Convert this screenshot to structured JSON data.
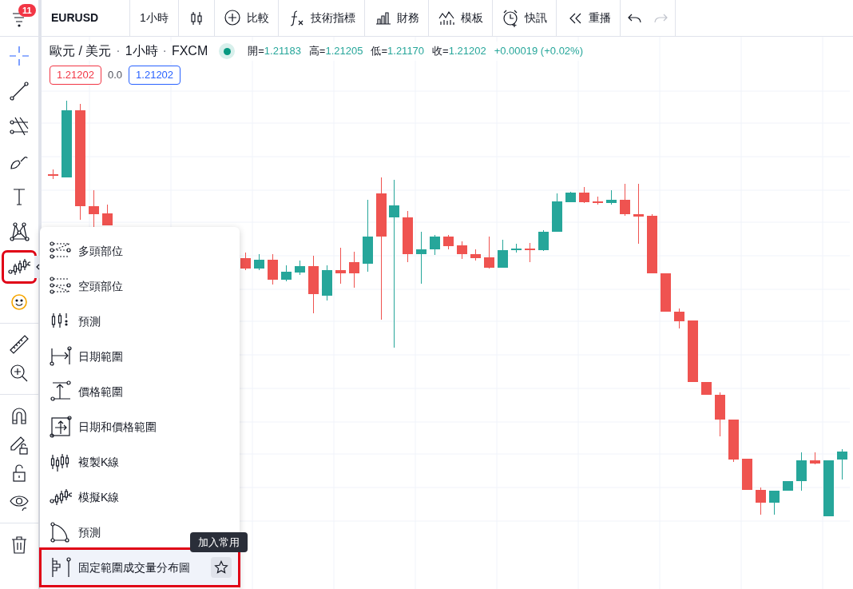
{
  "top_toolbar": {
    "menu_badge": "11",
    "symbol": "EURUSD",
    "interval": "1小時",
    "items": [
      {
        "kind": "compare",
        "label": "比較"
      },
      {
        "kind": "indicators",
        "label": "技術指標"
      },
      {
        "kind": "financials",
        "label": "財務"
      },
      {
        "kind": "templates",
        "label": "模板"
      },
      {
        "kind": "alert",
        "label": "快訊"
      },
      {
        "kind": "replay",
        "label": "重播"
      }
    ],
    "undo": {
      "disabled": false
    },
    "redo": {
      "disabled": true
    }
  },
  "legend": {
    "title": "歐元 / 美元",
    "interval": "1小時",
    "source": "FXCM",
    "separators": [
      "·",
      "·"
    ],
    "values": [
      {
        "label": "開=",
        "value": "1.21183"
      },
      {
        "label": "高=",
        "value": "1.21205"
      },
      {
        "label": "低=",
        "value": "1.21170"
      },
      {
        "label": "收=",
        "value": "1.21202"
      }
    ],
    "change": "+0.00019 (+0.02%)",
    "sell": "1.21202",
    "spread": "0.0",
    "buy": "1.21202"
  },
  "left_toolbar": [
    {
      "kind": "crosshair",
      "selected": true
    },
    {
      "kind": "trend-line",
      "selected": false
    },
    {
      "kind": "fib",
      "selected": false
    },
    {
      "kind": "brush",
      "selected": false
    },
    {
      "kind": "text",
      "selected": false
    },
    {
      "kind": "pattern",
      "selected": false
    },
    {
      "kind": "prediction",
      "selected": true
    },
    {
      "kind": "emoji",
      "selected": false
    },
    {
      "kind": "divider"
    },
    {
      "kind": "ruler",
      "selected": false
    },
    {
      "kind": "zoom",
      "selected": false
    },
    {
      "kind": "divider"
    },
    {
      "kind": "magnet",
      "selected": false
    },
    {
      "kind": "lock-drawing",
      "selected": false
    },
    {
      "kind": "lock",
      "selected": false
    },
    {
      "kind": "eye",
      "selected": false
    },
    {
      "kind": "divider"
    },
    {
      "kind": "trash",
      "selected": false
    }
  ],
  "tool_menu": {
    "items": [
      {
        "kind": "long",
        "label": "多頭部位",
        "hovered": false
      },
      {
        "kind": "short",
        "label": "空頭部位",
        "hovered": false
      },
      {
        "kind": "forecast",
        "label": "預測",
        "hovered": false
      },
      {
        "kind": "date-range",
        "label": "日期範圍",
        "hovered": false
      },
      {
        "kind": "price-range",
        "label": "價格範圍",
        "hovered": false
      },
      {
        "kind": "date-price-range",
        "label": "日期和價格範圍",
        "hovered": false
      },
      {
        "kind": "bars-pattern",
        "label": "複製K線",
        "hovered": false
      },
      {
        "kind": "ghost-feed",
        "label": "模擬K線",
        "hovered": false
      },
      {
        "kind": "projection",
        "label": "預測",
        "hovered": false
      },
      {
        "kind": "volume-profile",
        "label": "固定範圍成交量分布圖",
        "hovered": true
      }
    ],
    "tooltip": "加入常用"
  }
}
